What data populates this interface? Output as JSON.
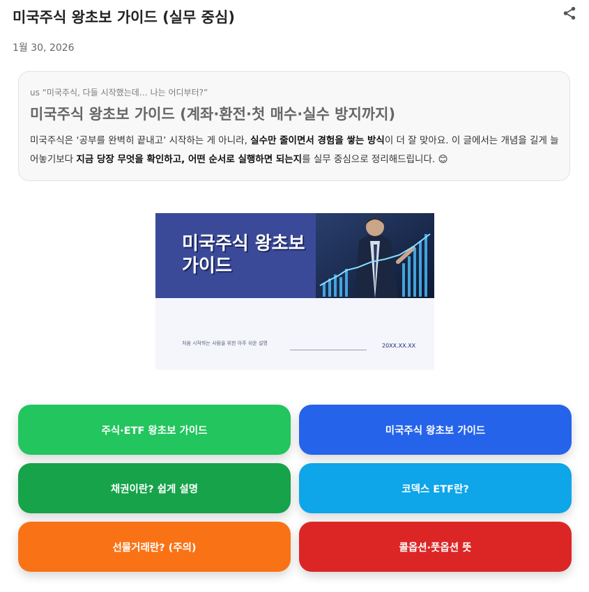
{
  "post": {
    "title": "미국주식 왕초보 가이드 (실무 중심)",
    "date": "1월 30, 2026"
  },
  "intro": {
    "kicker": "us “미국주식, 다들 시작했는데… 나는 어디부터?”",
    "heading": "미국주식 왕초보 가이드 (계좌·환전·첫 매수·실수 방지까지)",
    "body_1": "미국주식은 ‘공부를 완벽히 끝내고’ 시작하는 게 아니라, ",
    "body_bold_1": "실수만 줄이면서 경험을 쌓는 방식",
    "body_2": "이 더 잘 맞아요. 이 글에서는 개념을 길게 늘어놓기보다 ",
    "body_bold_2": "지금 당장 무엇을 확인하고, 어떤 순서로 실행하면 되는지",
    "body_3": "를 실무 중심으로 정리해드립니다. 😊"
  },
  "thumbnail": {
    "title": "미국주식 왕초보 가이드",
    "subtitle": "처음 시작하는 사람을 위한 아주 쉬운 설명",
    "date": "20XX.XX.XX"
  },
  "links": [
    {
      "label": "주식·ETF 왕초보 가이드",
      "color": "#22c55e"
    },
    {
      "label": "미국주식 왕초보 가이드",
      "color": "#2563eb"
    },
    {
      "label": "채권이란? 쉽게 설명",
      "color": "#16a34a"
    },
    {
      "label": "코덱스 ETF란?",
      "color": "#0ea5e9"
    },
    {
      "label": "선물거래란? (주의)",
      "color": "#f97316"
    },
    {
      "label": "콜옵션·풋옵션 뜻",
      "color": "#dc2626"
    }
  ],
  "icons": {
    "share": "share-icon"
  }
}
